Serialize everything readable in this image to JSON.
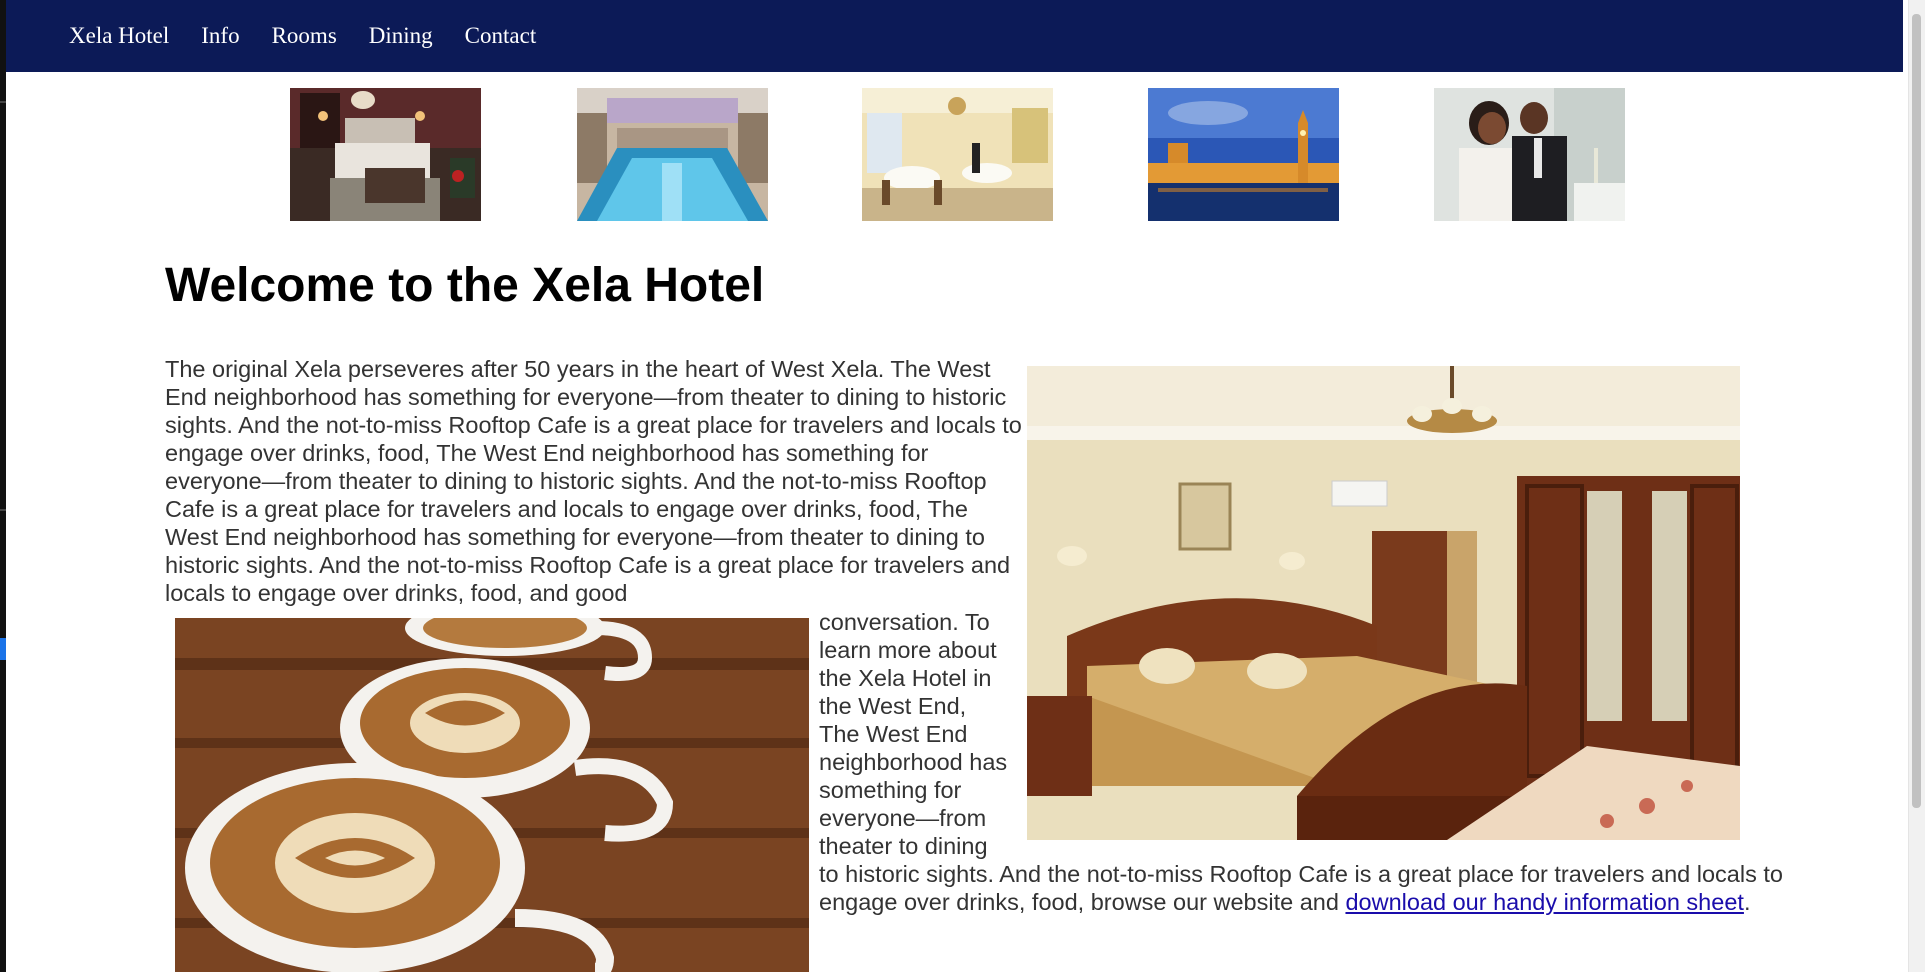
{
  "nav": {
    "items": [
      {
        "label": "Xela Hotel"
      },
      {
        "label": "Info"
      },
      {
        "label": "Rooms"
      },
      {
        "label": "Dining"
      },
      {
        "label": "Contact"
      }
    ]
  },
  "thumbnails": [
    {
      "subject": "hotel-room-photo"
    },
    {
      "subject": "indoor-pool-photo"
    },
    {
      "subject": "dining-room-photo"
    },
    {
      "subject": "parliament-night-photo"
    },
    {
      "subject": "couple-dining-photo"
    }
  ],
  "main": {
    "title": "Welcome to the Xela Hotel",
    "para_top": "The original Xela perseveres after 50 years in the heart of West Xela. The West End neighborhood has something for everyone—from theater to dining to historic sights. And the not-to-miss Rooftop Cafe is a great place for travelers and locals to engage over drinks, food, The West End neighborhood has something for everyone—from theater to dining to historic sights. And the not-to-miss Rooftop Cafe is a great place for travelers and locals to engage over drinks, food, The West End neighborhood has something for everyone—from theater to dining to historic sights. And the not-to-miss Rooftop Cafe is a great place for travelers and locals to engage over drinks, food, and good",
    "para_narrow": "conversation.  To learn more about the Xela Hotel in the West End, The West End neighborhood has something for everyone—from theater to dining",
    "para_bottom": "to historic sights. And the not-to-miss Rooftop Cafe is a great place for travelers and locals to engage over drinks, food, browse our website and ",
    "link_text": "download our handy information sheet",
    "para_end": "."
  },
  "colors": {
    "nav_bg": "#0c1a57",
    "nav_text": "#ffffff",
    "body_text": "#333333",
    "link": "#1a0dab"
  }
}
